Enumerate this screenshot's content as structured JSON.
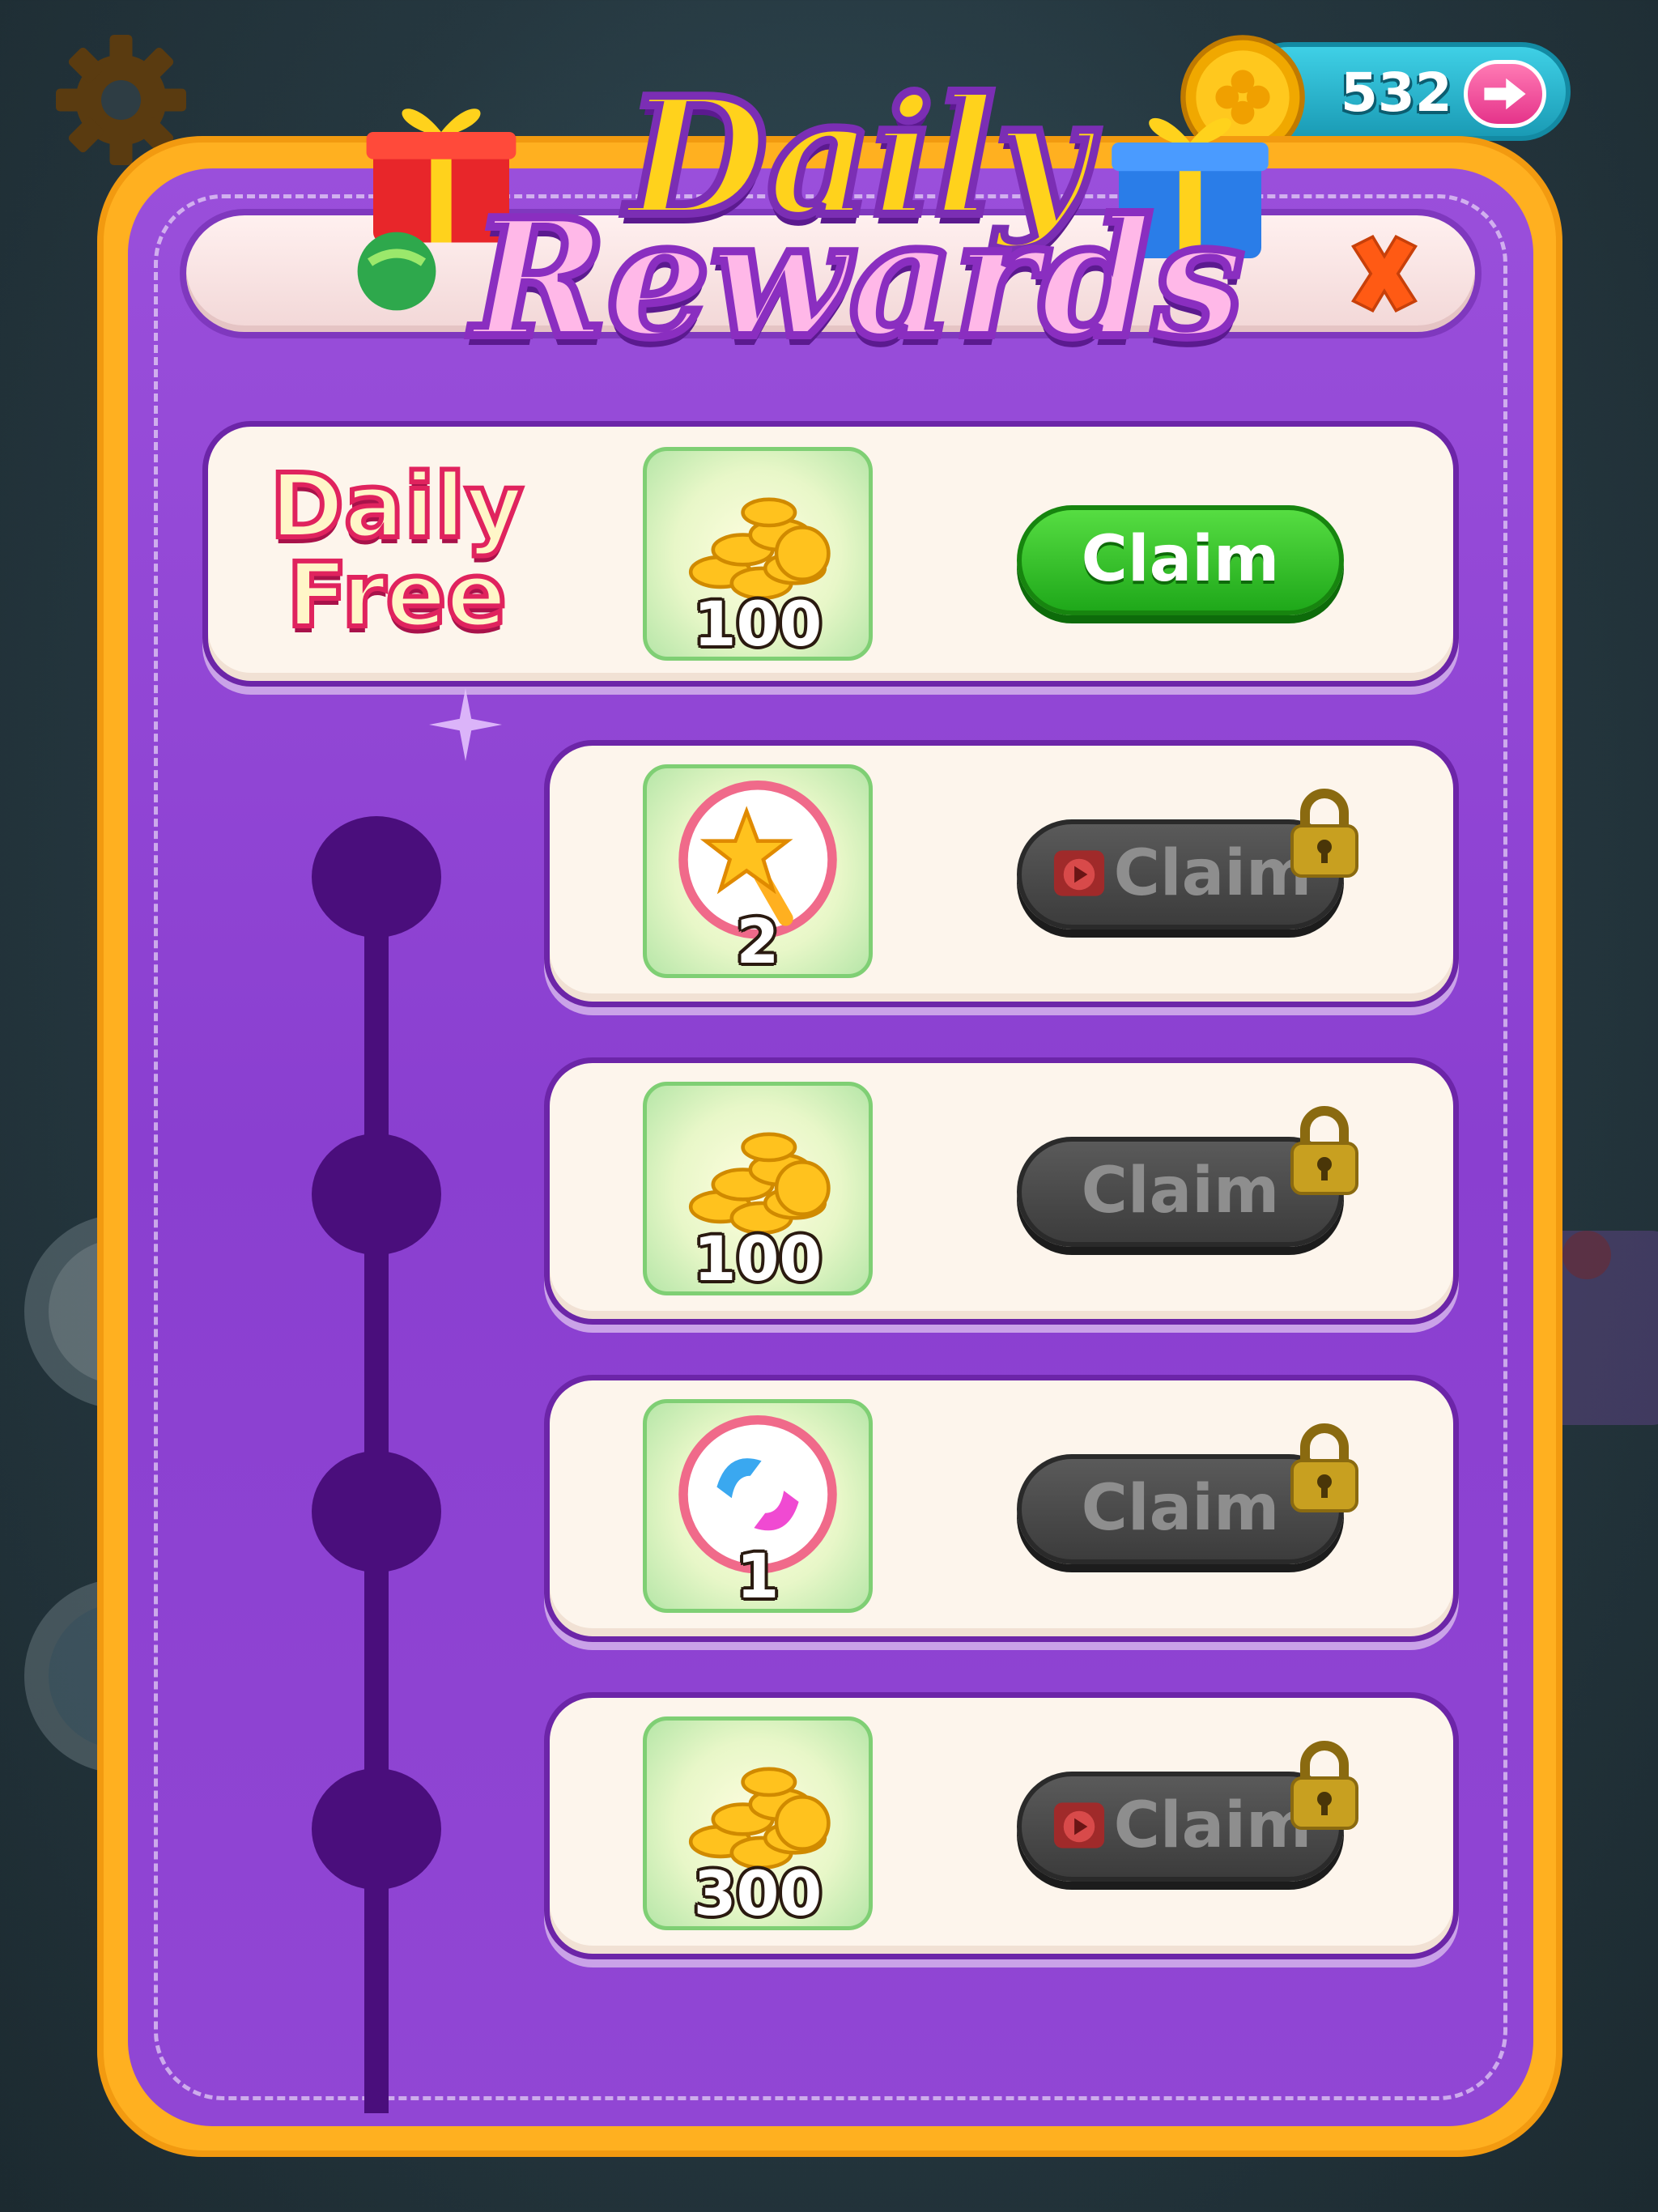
{
  "hud": {
    "coin_value": "532",
    "icons": [
      "settings-gear-icon",
      "coin-icon",
      "arrow-right-icon"
    ]
  },
  "dialog": {
    "title_line1": "Daily",
    "title_line2": "Rewards",
    "close_icon": "close-x-icon",
    "daily_free_label": "Daily\nFree"
  },
  "rewards": [
    {
      "kind": "coins",
      "icon": "coin-pile-icon",
      "count": "100",
      "button_label": "Claim",
      "state": "available",
      "requires_ad": false
    },
    {
      "kind": "magic-wand",
      "icon": "star-wand-icon",
      "count": "2",
      "button_label": "Claim",
      "state": "locked",
      "requires_ad": true
    },
    {
      "kind": "coins",
      "icon": "coin-pile-icon",
      "count": "100",
      "button_label": "Claim",
      "state": "locked",
      "requires_ad": false
    },
    {
      "kind": "swap",
      "icon": "swap-candy-icon",
      "count": "1",
      "button_label": "Claim",
      "state": "locked",
      "requires_ad": false
    },
    {
      "kind": "coins",
      "icon": "coin-pile-icon",
      "count": "300",
      "button_label": "Claim",
      "state": "locked",
      "requires_ad": true
    }
  ],
  "colors": {
    "panel_border": "#ffb020",
    "panel_fill": "#8a3fd0",
    "claim_active": "#1fa81a",
    "claim_locked": "#3c3c3c",
    "timeline": "#4a0e7c"
  }
}
